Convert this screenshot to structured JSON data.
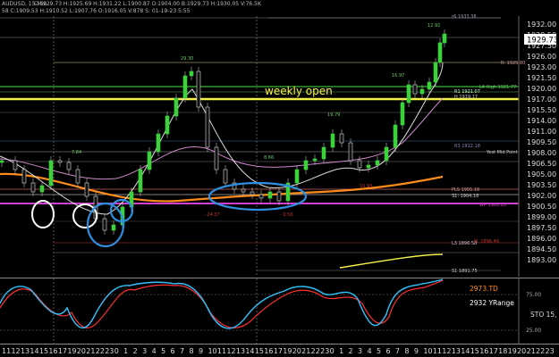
{
  "header": {
    "symbol": "AUDUSD, 15-Min",
    "ohlc": "C:1929.73  H:1925.69  H:1931.22  L:1900.87  O:1904.00  B:1929.73  H:1930.05  V:76.5K",
    "info2": "58   C:1909.53  H:1910.52  L:1907.76  O:1916.05  V:878  S:  01-19-23  5:55"
  },
  "current_price": "1929.73",
  "price_axis": [
    "1932.00",
    "1929.50",
    "1927.50",
    "1926.00",
    "1923.00",
    "1921.50",
    "1920.00",
    "1917.00",
    "1915.50",
    "1914.00",
    "1911.00",
    "1909.50",
    "1908.00",
    "1906.50",
    "1905.00",
    "1903.50",
    "1902.00",
    "1900.50",
    "1899.00",
    "1897.50",
    "1896.00",
    "1894.50",
    "1893.00"
  ],
  "annotations": {
    "weekly_open": "weekly open",
    "r6": "r6 1933.38",
    "h_top": "12.92",
    "r3_high": "R: 1925.80",
    "h2": "16.97",
    "l4_high": "L4 High 1921.77",
    "r1": "R1  1921.07",
    "h3": "H  1919.17",
    "h_2930": "29.30",
    "h_1979": "19.79",
    "r3": "R3  1912.18",
    "yest_mid": "Yest Mid Point",
    "lo_1": "7.84",
    "lo_2": "8.66",
    "lo_3": "10.93",
    "pp": "PLS  1905.18",
    "s1": "S1:  1904.18",
    "wp": "WP  1902.83",
    "low_1": "- 24.37",
    "low_2": "- 0.50",
    "l3": "L3  1896.58",
    "fl": "FL  1896.49",
    "s1_low": "S1  1891.75"
  },
  "indicator": {
    "td": "2973.TD",
    "yrange": "2932 YRange",
    "sto": "STO 15,",
    "lvl_75": "75.00",
    "lvl_25": "25.00"
  },
  "time_axis": [
    "11",
    "12",
    "13",
    "14",
    "15",
    "16",
    "17",
    "19",
    "20",
    "21",
    "22",
    "23",
    "0",
    "1",
    "2",
    "3",
    "4",
    "5",
    "6",
    "7",
    "8",
    "9",
    "10",
    "11",
    "12",
    "13",
    "14",
    "15",
    "16",
    "17",
    "19",
    "20",
    "21",
    "22",
    "23",
    "0",
    "1",
    "2",
    "3",
    "4",
    "5",
    "6",
    "7",
    "8",
    "9",
    "10",
    "11",
    "12",
    "13",
    "14",
    "15",
    "16",
    "17",
    "18",
    "19",
    "20",
    "21",
    "22",
    "23"
  ],
  "colors": {
    "background": "#000000",
    "weekly_open": "#f5f04a",
    "ema_orange": "#ff8c1a",
    "pivot_magenta": "#d040d0",
    "ellipse_blue": "#2f8fe0",
    "ellipse_white": "#ffffff",
    "sto_cyan": "#34c3ff",
    "sto_red": "#ff3030"
  }
}
